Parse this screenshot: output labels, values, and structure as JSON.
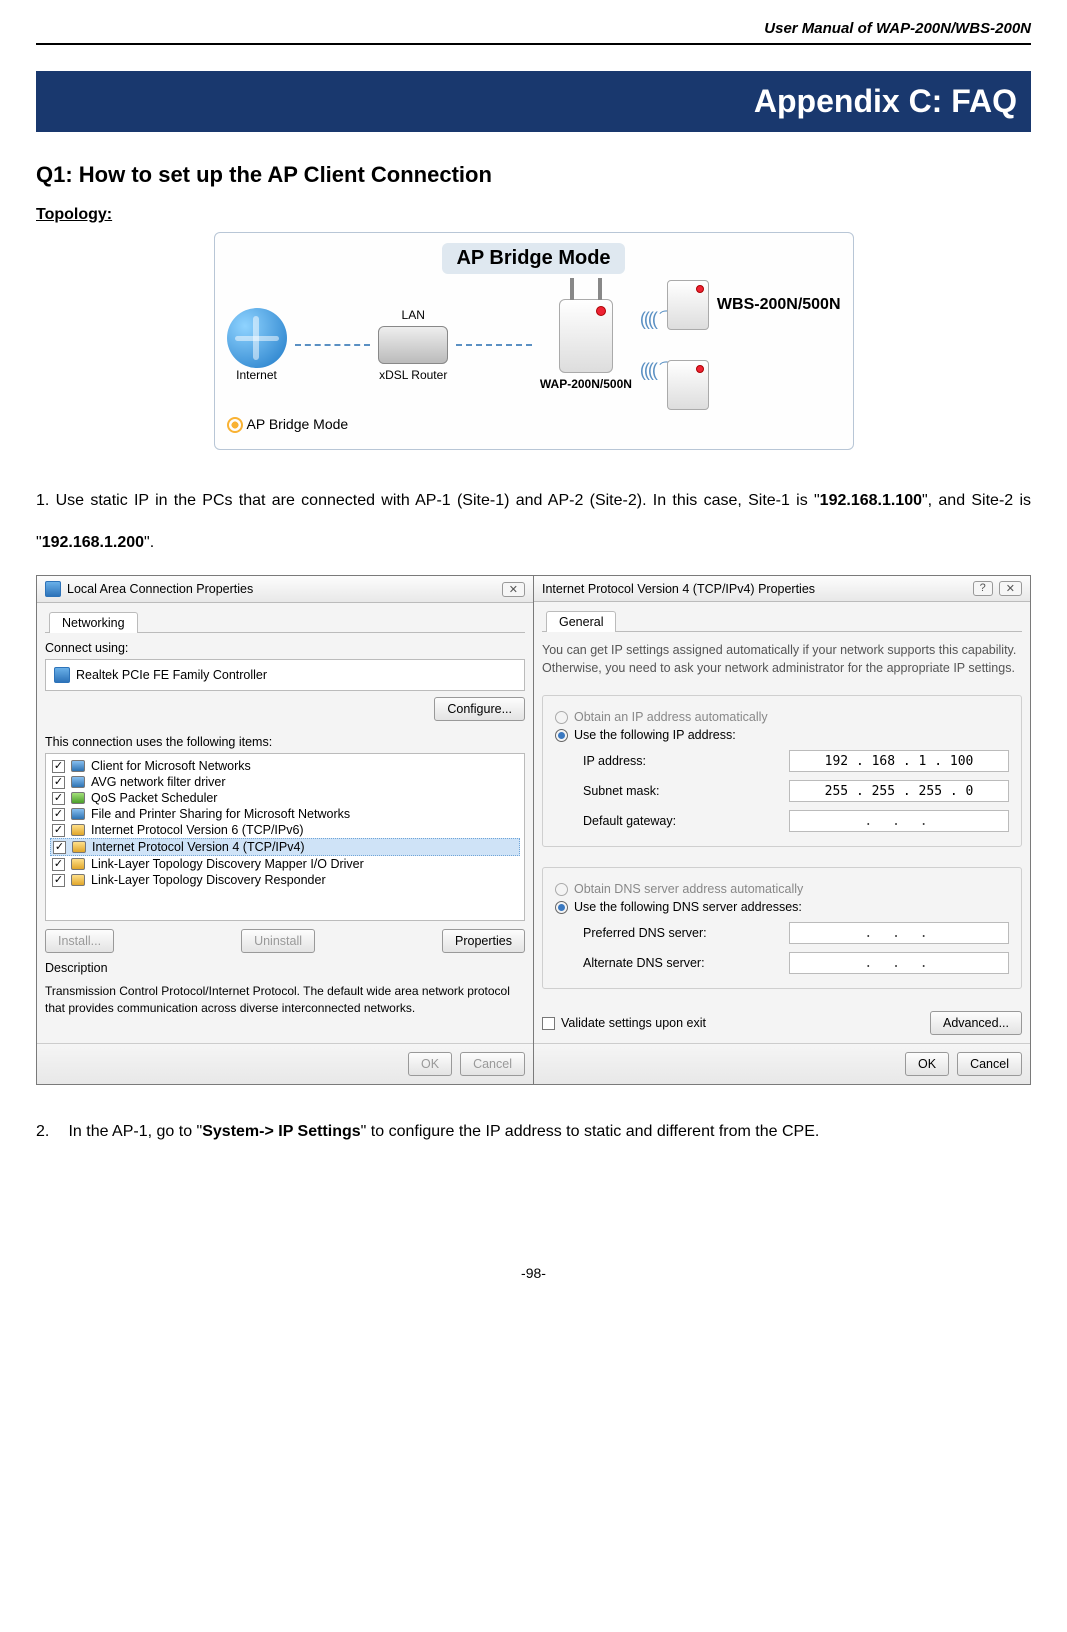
{
  "running_head": "User Manual of WAP-200N/WBS-200N",
  "appendix_title": "Appendix C: FAQ",
  "q1_heading": "Q1: How to set up the AP Client Connection",
  "topology_label": "Topology:",
  "topology": {
    "title": "AP Bridge Mode",
    "internet_label": "Internet",
    "lan_label": "LAN",
    "router_label": "xDSL Router",
    "center_device": "WAP-200N/500N",
    "right_device": "WBS-200N/500N",
    "mode_badge": "AP Bridge Mode"
  },
  "step1": {
    "pre": "1. Use static IP in the PCs that are connected with AP-1 (Site-1) and AP-2 (Site-2). In this case, Site-1 is \"",
    "ip1": "192.168.1.100",
    "mid": "\", and Site-2 is \"",
    "ip2": "192.168.1.200",
    "post": "\"."
  },
  "dlg_left": {
    "title": "Local Area Connection Properties",
    "close": "✕",
    "tab": "Networking",
    "connect_using_label": "Connect using:",
    "adapter": "Realtek PCIe FE Family Controller",
    "configure_btn": "Configure...",
    "items_label": "This connection uses the following items:",
    "items": [
      {
        "label": "Client for Microsoft Networks",
        "icon": "blue",
        "checked": true
      },
      {
        "label": "AVG network filter driver",
        "icon": "blue",
        "checked": true
      },
      {
        "label": "QoS Packet Scheduler",
        "icon": "grn",
        "checked": true
      },
      {
        "label": "File and Printer Sharing for Microsoft Networks",
        "icon": "blue",
        "checked": true
      },
      {
        "label": "Internet Protocol Version 6 (TCP/IPv6)",
        "icon": "yel",
        "checked": true
      },
      {
        "label": "Internet Protocol Version 4 (TCP/IPv4)",
        "icon": "yel",
        "checked": true,
        "selected": true
      },
      {
        "label": "Link-Layer Topology Discovery Mapper I/O Driver",
        "icon": "yel",
        "checked": true
      },
      {
        "label": "Link-Layer Topology Discovery Responder",
        "icon": "yel",
        "checked": true
      }
    ],
    "install_btn": "Install...",
    "uninstall_btn": "Uninstall",
    "properties_btn": "Properties",
    "description_label": "Description",
    "description_text": "Transmission Control Protocol/Internet Protocol. The default wide area network protocol that provides communication across diverse interconnected networks.",
    "ok_btn": "OK",
    "cancel_btn": "Cancel"
  },
  "dlg_right": {
    "title": "Internet Protocol Version 4 (TCP/IPv4) Properties",
    "help": "?",
    "close": "✕",
    "tab": "General",
    "hint": "You can get IP settings assigned automatically if your network supports this capability. Otherwise, you need to ask your network administrator for the appropriate IP settings.",
    "radio_auto_ip": "Obtain an IP address automatically",
    "radio_static_ip": "Use the following IP address:",
    "ip_label": "IP address:",
    "ip_value": "192 . 168 .   1   . 100",
    "mask_label": "Subnet mask:",
    "mask_value": "255 . 255 . 255 .   0",
    "gw_label": "Default gateway:",
    "gw_value": ".       .       .",
    "radio_auto_dns": "Obtain DNS server address automatically",
    "radio_static_dns": "Use the following DNS server addresses:",
    "dns1_label": "Preferred DNS server:",
    "dns1_value": ".       .       .",
    "dns2_label": "Alternate DNS server:",
    "dns2_value": ".       .       .",
    "validate_label": "Validate settings upon exit",
    "advanced_btn": "Advanced...",
    "ok_btn": "OK",
    "cancel_btn": "Cancel"
  },
  "step2": {
    "num": "2.",
    "pre": "In the AP-1, go to \"",
    "bold": "System-> IP Settings",
    "post": "\" to configure the IP address to static and different from the CPE."
  },
  "page_number": "-98-"
}
